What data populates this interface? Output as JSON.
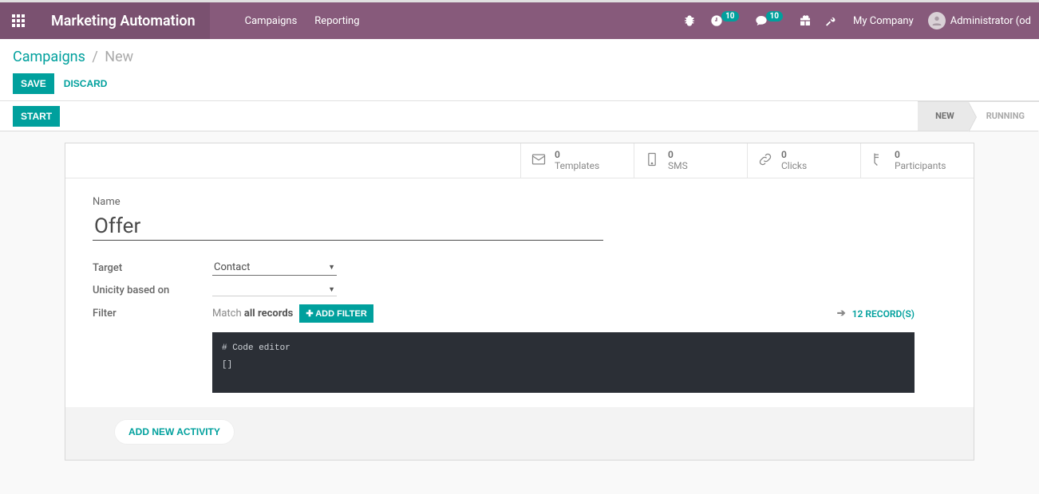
{
  "navbar": {
    "app_title": "Marketing Automation",
    "menu": {
      "campaigns": "Campaigns",
      "reporting": "Reporting"
    },
    "clock_badge": "10",
    "chat_badge": "10",
    "company": "My Company",
    "user": "Administrator (od"
  },
  "breadcrumb": {
    "link": "Campaigns",
    "sep": "/",
    "current": "New"
  },
  "buttons": {
    "save": "SAVE",
    "discard": "DISCARD",
    "start": "START"
  },
  "stages": {
    "new": "NEW",
    "running": "RUNNING"
  },
  "stats": {
    "templates": {
      "count": "0",
      "label": "Templates"
    },
    "sms": {
      "count": "0",
      "label": "SMS"
    },
    "clicks": {
      "count": "0",
      "label": "Clicks"
    },
    "participants": {
      "count": "0",
      "label": "Participants"
    }
  },
  "form": {
    "name_label": "Name",
    "name_value": "Offer",
    "target_label": "Target",
    "target_value": "Contact",
    "unicity_label": "Unicity based on",
    "unicity_value": "",
    "filter_label": "Filter",
    "match_prefix": "Match ",
    "match_bold": "all records",
    "add_filter": "ADD FILTER",
    "records": "12 RECORD(S)",
    "code_comment": "# Code editor",
    "code_body": "[]",
    "add_activity": "ADD NEW ACTIVITY"
  }
}
